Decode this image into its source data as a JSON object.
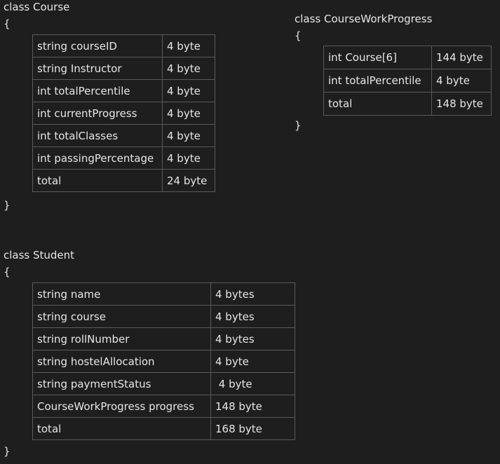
{
  "course": {
    "header": "class Course",
    "open_brace": "{",
    "close_brace": "}",
    "rows": [
      {
        "field": "string courseID",
        "size": "4 byte"
      },
      {
        "field": "string Instructor",
        "size": "4 byte"
      },
      {
        "field": "int totalPercentile",
        "size": "4 byte"
      },
      {
        "field": "int currentProgress",
        "size": "4 byte"
      },
      {
        "field": "int totalClasses",
        "size": "4 byte"
      },
      {
        "field": "int passingPercentage",
        "size": "4 byte"
      },
      {
        "field": "total",
        "size": "24 byte"
      }
    ]
  },
  "coursework": {
    "header": "class CourseWorkProgress",
    "open_brace": "{",
    "close_brace": "}",
    "rows": [
      {
        "field": "int Course[6]",
        "size": "144 byte"
      },
      {
        "field": "int totalPercentile",
        "size": "4 byte"
      },
      {
        "field": "total",
        "size": "148 byte"
      }
    ]
  },
  "student": {
    "header": "class Student",
    "open_brace": "{",
    "close_brace": "}",
    "rows": [
      {
        "field": "string name",
        "size": "4 bytes"
      },
      {
        "field": "string course",
        "size": "4 bytes"
      },
      {
        "field": "string rollNumber",
        "size": "4 bytes"
      },
      {
        "field": "string hostelAllocation",
        "size": "4 byte"
      },
      {
        "field": "string paymentStatus",
        "size": " 4 byte"
      },
      {
        "field": "CourseWorkProgress progress",
        "size": "148 byte"
      },
      {
        "field": "total",
        "size": "168 byte"
      }
    ]
  }
}
